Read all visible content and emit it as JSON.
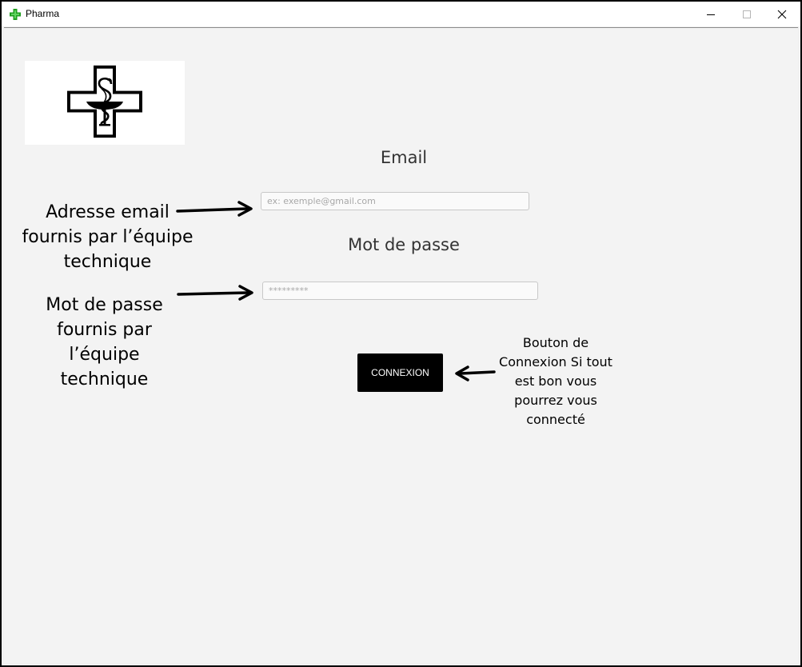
{
  "window": {
    "title": "Pharma",
    "icons": {
      "app": "pharmacy-cross-icon",
      "minimize": "minimize-icon",
      "maximize": "maximize-icon",
      "close": "close-icon"
    }
  },
  "logo": {
    "icon": "pharmacy-caduceus-cross-logo"
  },
  "form": {
    "email_label": "Email",
    "email_placeholder": "ex: exemple@gmail.com",
    "email_value": "",
    "password_label": "Mot de passe",
    "password_placeholder": "*********",
    "password_value": "",
    "login_button": "CONNEXION"
  },
  "annotations": {
    "email": [
      "Adresse email",
      "fournis par l’équipe",
      "technique"
    ],
    "password": [
      "Mot de passe",
      "fournis par",
      "l’équipe",
      "technique"
    ],
    "button": [
      "Bouton de",
      "Connexion Si tout",
      "est bon vous",
      "pourrez vous",
      "connecté"
    ]
  },
  "colors": {
    "accent_green": "#1e9e1e",
    "button_bg": "#000000",
    "background": "#f3f3f3"
  }
}
